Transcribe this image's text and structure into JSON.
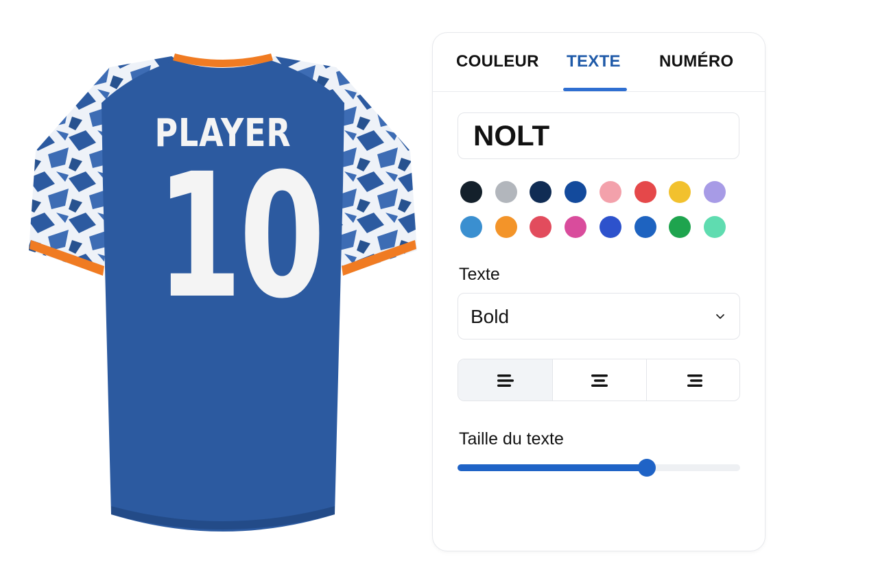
{
  "jersey": {
    "name": "PLAYER",
    "number": "10",
    "body_color": "#2c5aa0",
    "trim_color": "#f07b22"
  },
  "tabs": [
    {
      "label": "COULEUR",
      "active": false
    },
    {
      "label": "TEXTE",
      "active": true
    },
    {
      "label": "NUMÉRO",
      "active": false
    }
  ],
  "text_input": {
    "value": "NOLT"
  },
  "swatches": [
    "#14202b",
    "#b2b6bc",
    "#102c54",
    "#134a9c",
    "#f3a1ab",
    "#e5484a",
    "#f2c12e",
    "#a79be6",
    "#3a8fd0",
    "#f39429",
    "#e24c5d",
    "#d94c9c",
    "#2d52cc",
    "#1e63c0",
    "#1ea44e",
    "#5fdcb0"
  ],
  "font_section": {
    "label": "Texte",
    "selected": "Bold"
  },
  "alignment": {
    "options": [
      "left",
      "center",
      "right"
    ],
    "selected": "left"
  },
  "size_section": {
    "label": "Taille du texte",
    "value_fraction": 0.67
  },
  "icons": {
    "chevron": "chevron-down-icon"
  }
}
